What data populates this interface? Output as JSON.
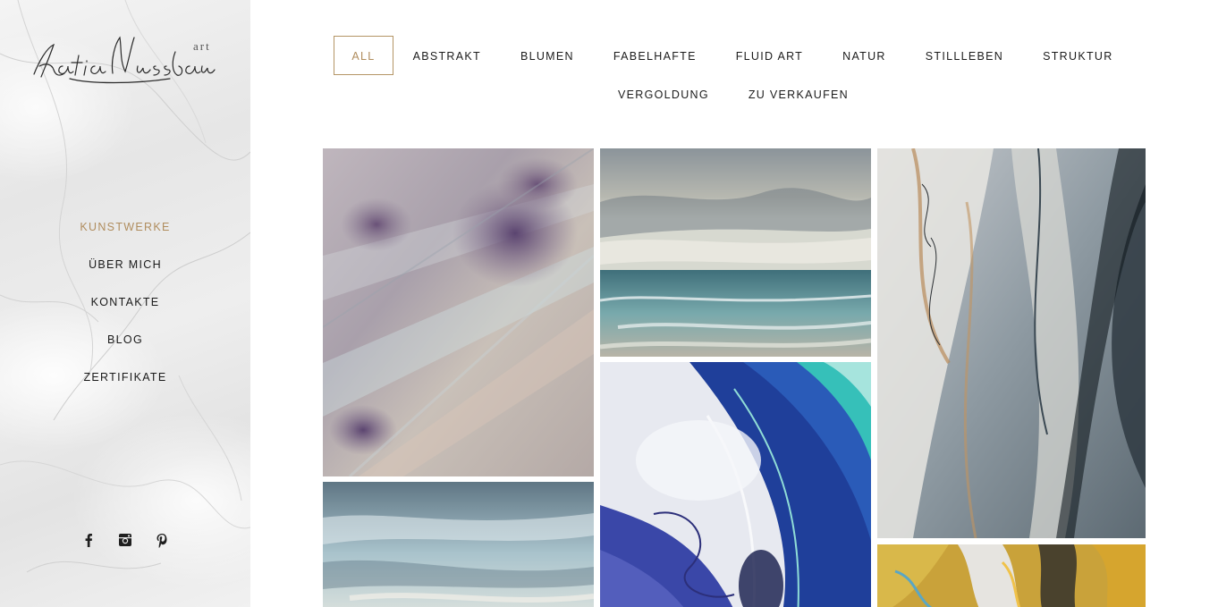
{
  "logo": {
    "text": "Katia Nussbaumer",
    "tag": "art"
  },
  "nav": [
    {
      "label": "KUNSTWERKE",
      "active": true
    },
    {
      "label": "ÜBER MICH",
      "active": false
    },
    {
      "label": "KONTAKTE",
      "active": false
    },
    {
      "label": "BLOG",
      "active": false
    },
    {
      "label": "ZERTIFIKATE",
      "active": false
    }
  ],
  "social": [
    {
      "icon": "facebook-icon"
    },
    {
      "icon": "instagram-icon"
    },
    {
      "icon": "pinterest-icon"
    }
  ],
  "filters": {
    "row1": [
      "ALL",
      "ABSTRAKT",
      "BLUMEN",
      "FABELHAFTE",
      "FLUID ART",
      "NATUR",
      "STILLLEBEN",
      "STRUKTUR"
    ],
    "row2": [
      "VERGOLDUNG",
      "ZU VERKAUFEN"
    ],
    "active": "ALL"
  },
  "gallery": [
    {
      "name": "artwork-purple-textured-abstract"
    },
    {
      "name": "artwork-seascape-clouds"
    },
    {
      "name": "artwork-grey-fluid-abstract"
    },
    {
      "name": "artwork-blue-sky-clouds"
    },
    {
      "name": "artwork-blue-fluid-wave"
    },
    {
      "name": "artwork-yellow-fluid-abstract"
    }
  ],
  "colors": {
    "accent": "#b08d5e",
    "text": "#1c1c1c",
    "sidebar": "#ececec"
  }
}
